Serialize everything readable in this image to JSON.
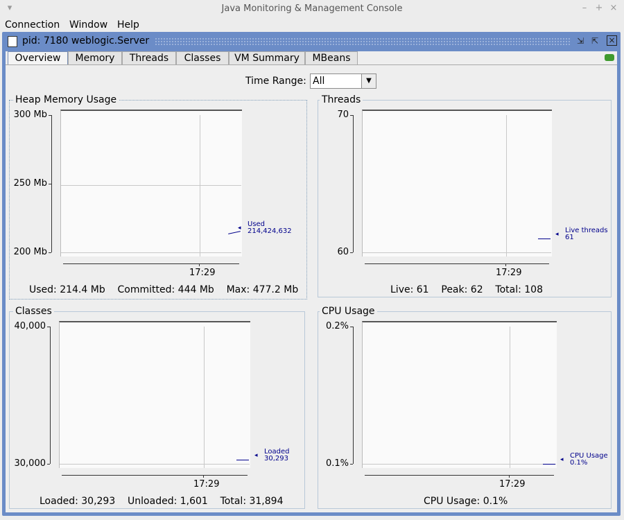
{
  "window": {
    "title": "Java Monitoring & Management Console"
  },
  "menu": [
    {
      "label": "Connection"
    },
    {
      "label": "Window"
    },
    {
      "label": "Help"
    }
  ],
  "internal_frame": {
    "title": "pid: 7180 weblogic.Server"
  },
  "tabs": [
    {
      "label": "Overview",
      "active": true
    },
    {
      "label": "Memory"
    },
    {
      "label": "Threads"
    },
    {
      "label": "Classes"
    },
    {
      "label": "VM Summary"
    },
    {
      "label": "MBeans"
    }
  ],
  "time_range": {
    "label": "Time Range:",
    "value": "All"
  },
  "colors": {
    "frame": "#6b8cc7",
    "series": "#00008b",
    "connected": "#3f9a2e"
  },
  "panels": {
    "heap": {
      "title": "Heap Memory Usage",
      "summary": "Used: 214.4 Mb    Committed: 444 Mb    Max: 477.2 Mb"
    },
    "threads": {
      "title": "Threads",
      "summary": "Live: 61    Peak: 62    Total: 108"
    },
    "classes": {
      "title": "Classes",
      "summary": "Loaded: 30,293    Unloaded: 1,601    Total: 31,894"
    },
    "cpu": {
      "title": "CPU Usage",
      "summary": "CPU Usage: 0.1%"
    }
  },
  "chart_data": [
    {
      "type": "line",
      "title": "Heap Memory Usage",
      "y_ticks": [
        "300 Mb",
        "250 Mb",
        "200 Mb"
      ],
      "x_ticks": [
        "17:29"
      ],
      "ylim": [
        200,
        300
      ],
      "series": [
        {
          "name": "Used",
          "value_label": "214,424,632",
          "values": [
            214.4
          ]
        }
      ]
    },
    {
      "type": "line",
      "title": "Threads",
      "y_ticks": [
        "70",
        "60"
      ],
      "x_ticks": [
        "17:29"
      ],
      "ylim": [
        60,
        70
      ],
      "series": [
        {
          "name": "Live threads",
          "value_label": "61",
          "values": [
            61
          ]
        }
      ]
    },
    {
      "type": "line",
      "title": "Classes",
      "y_ticks": [
        "40,000",
        "30,000"
      ],
      "x_ticks": [
        "17:29"
      ],
      "ylim": [
        30000,
        40000
      ],
      "series": [
        {
          "name": "Loaded",
          "value_label": "30,293",
          "values": [
            30293
          ]
        }
      ]
    },
    {
      "type": "line",
      "title": "CPU Usage",
      "y_ticks": [
        "0.2%",
        "0.1%"
      ],
      "x_ticks": [
        "17:29"
      ],
      "ylim": [
        0.1,
        0.2
      ],
      "series": [
        {
          "name": "CPU Usage",
          "value_label": "0.1%",
          "values": [
            0.1
          ]
        }
      ]
    }
  ]
}
